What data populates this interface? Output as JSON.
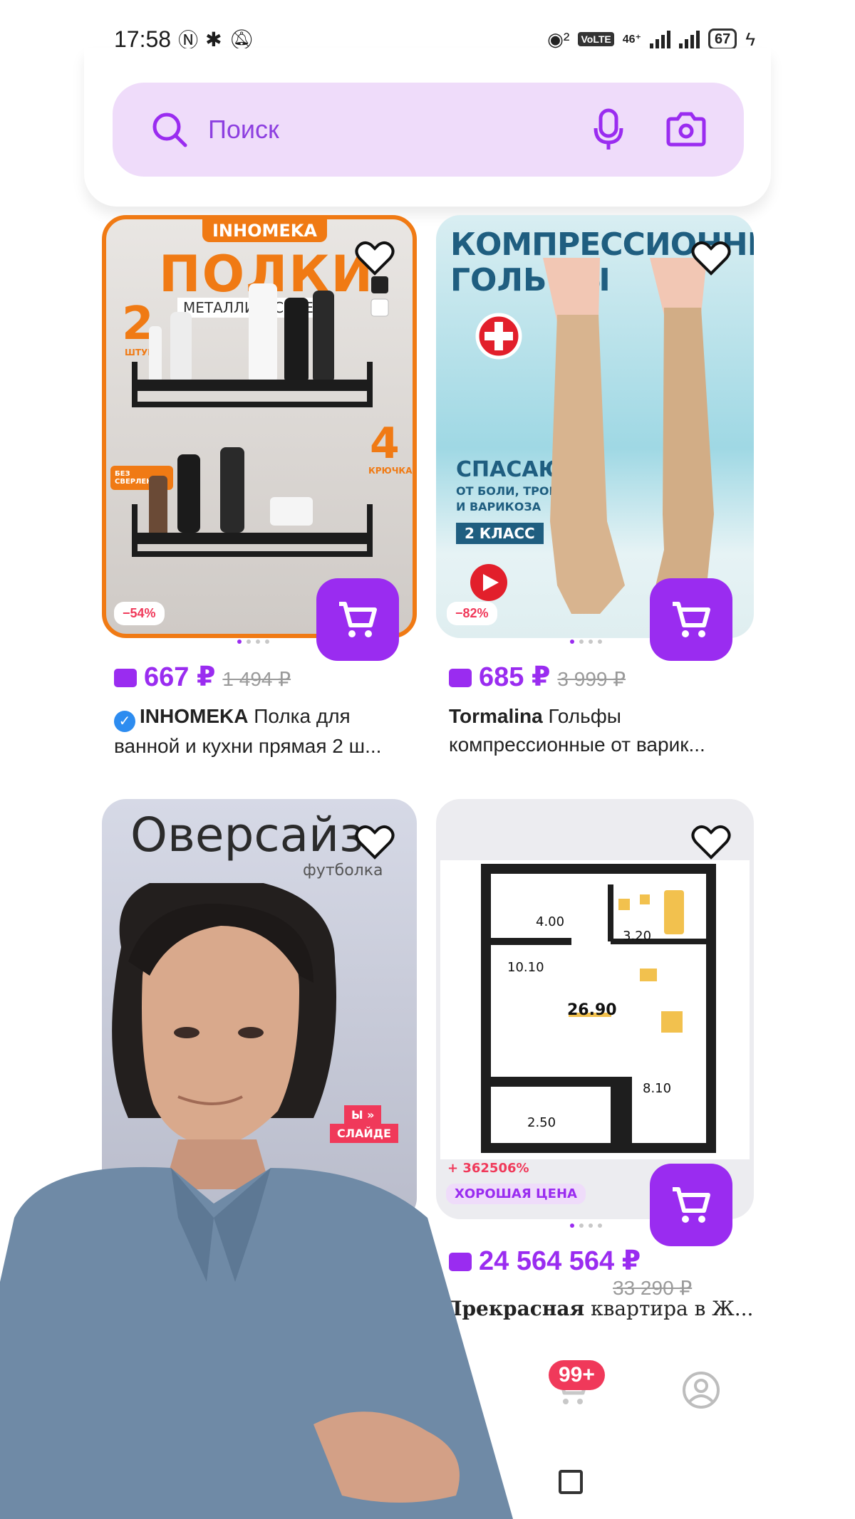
{
  "status_bar": {
    "time": "17:58",
    "signal_label_1": "46⁺",
    "battery": "67",
    "volte": "VoLTE"
  },
  "search": {
    "placeholder": "Поиск"
  },
  "products": [
    {
      "image_texts": [
        "INHOMEKA",
        "ПОЛКИ",
        "МЕТАЛЛИЧЕСКИЕ",
        "2",
        "ШТУКИ",
        "4",
        "КРЮЧКА",
        "БЕЗ СВЕРЛЕНИЯ"
      ],
      "discount": "−54%",
      "price": "667 ₽",
      "old_price": "1 494 ₽",
      "brand": "INHOMEKA",
      "title": "Полка для ванной и кухни прямая 2 ш..."
    },
    {
      "image_texts": [
        "КОМПРЕССИОННЫЕ",
        "ГОЛЬФЫ",
        "СПАСАЮТ",
        "ОТ БОЛИ, ТРОМБОЗА",
        "И ВАРИКОЗА",
        "2 КЛАСС"
      ],
      "discount": "−82%",
      "price": "685 ₽",
      "old_price": "3 999 ₽",
      "brand": "Tormalina",
      "title": "Гольфы компрессионные от варик..."
    },
    {
      "image_texts": [
        "Оверсайз",
        "футболка",
        "Ы »",
        "СЛАЙДЕ"
      ]
    },
    {
      "image_texts": [
        "4.00",
        "3.20",
        "10.10",
        "26.90",
        "8.10",
        "2.50"
      ],
      "growth": "+ 362506%",
      "tag": "ХОРОШАЯ ЦЕНА",
      "price": "24 564 564 ₽",
      "old_price": "33 290 ₽",
      "brand": "Прекрасная",
      "title": "квартира в Ж..."
    }
  ],
  "nav": {
    "cart_badge": "99+"
  },
  "colors": {
    "accent": "#9a2cf0",
    "search_bg": "#efdcfa",
    "discount": "#f0395a",
    "orange": "#f07a14"
  }
}
